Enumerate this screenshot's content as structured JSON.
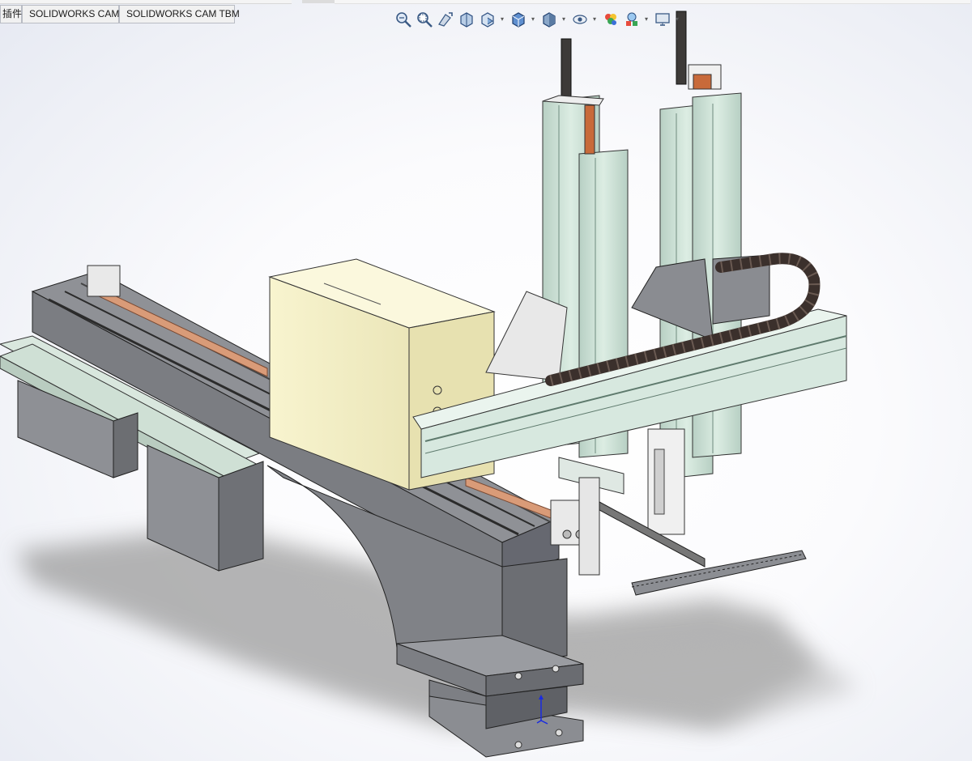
{
  "window": {
    "tabs": [
      {
        "label": "插件"
      },
      {
        "label": "SOLIDWORKS CAM"
      },
      {
        "label": "SOLIDWORKS CAM TBM"
      }
    ]
  },
  "heads_up_toolbar": {
    "items": [
      {
        "icon": "zoom-to-fit-icon"
      },
      {
        "icon": "zoom-to-area-icon"
      },
      {
        "icon": "previous-view-icon"
      },
      {
        "icon": "section-view-icon"
      },
      {
        "icon": "dynamic-annotation-view-icon",
        "has_dropdown": true
      },
      {
        "icon": "view-orientation-icon",
        "has_dropdown": true
      },
      {
        "icon": "display-style-icon",
        "has_dropdown": true
      },
      {
        "icon": "hide-show-items-icon",
        "has_dropdown": true
      },
      {
        "icon": "edit-appearance-icon"
      },
      {
        "icon": "apply-scene-icon",
        "has_dropdown": true
      },
      {
        "icon": "view-settings-icon",
        "has_dropdown": true
      }
    ]
  },
  "colors": {
    "frame_grey": "#8d8f94",
    "column_green": "#cfe3d8",
    "housing_cream": "#f5f1c8",
    "cable_chain": "#3b302c",
    "copper_strip": "#d99b78",
    "triad_blue": "#1a2be0"
  }
}
